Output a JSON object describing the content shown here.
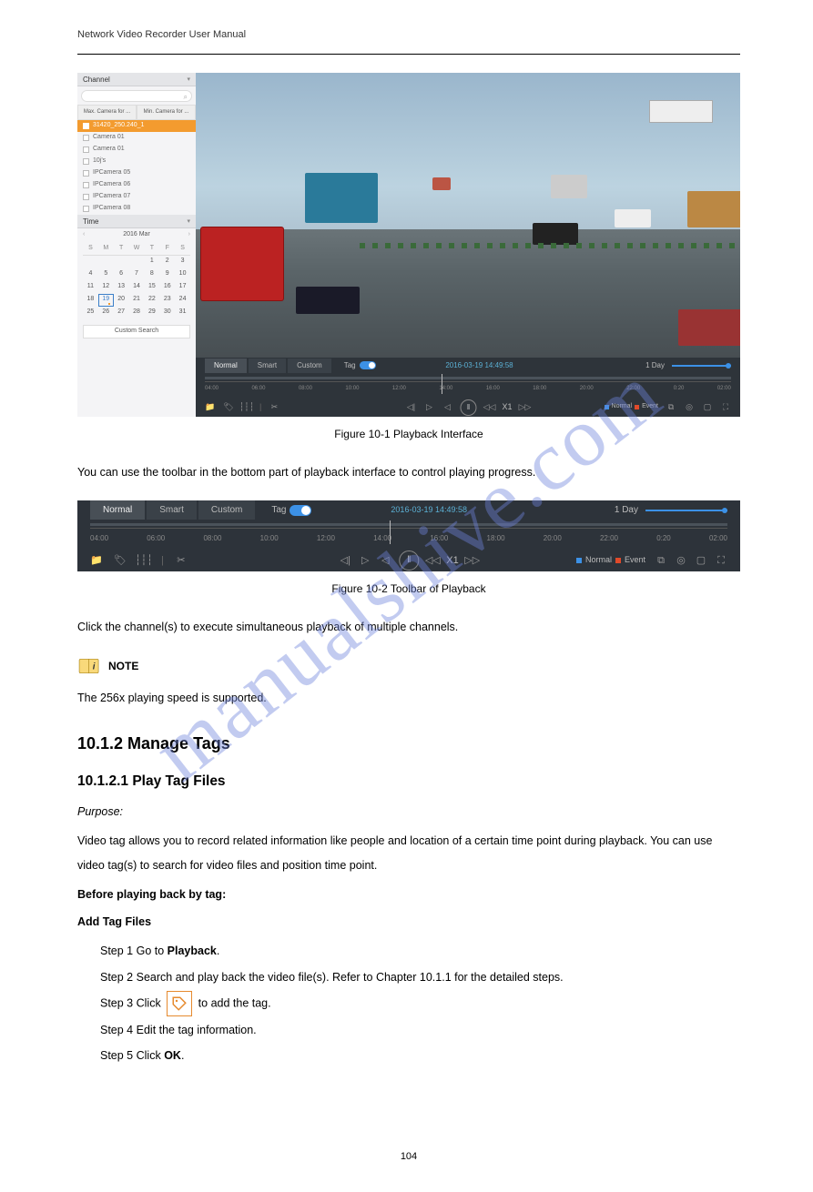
{
  "header": "Network Video Recorder User Manual",
  "watermark": "manualshive.com",
  "footer_page": "104",
  "fig1": {
    "channel_label": "Channel",
    "tab1": "Max. Camera for ...",
    "tab2": "Min. Camera for ...",
    "cams": [
      "31420_250.240_1",
      "Camera 01",
      "Camera 01",
      "10j's",
      "IPCamera 05",
      "IPCamera 06",
      "IPCamera 07",
      "IPCamera 08"
    ],
    "time_label": "Time",
    "cal_month": "2016 Mar",
    "dow": [
      "S",
      "M",
      "T",
      "W",
      "T",
      "F",
      "S"
    ],
    "today": "19",
    "custom_search": "Custom Search",
    "type_normal": "Normal",
    "type_smart": "Smart",
    "type_custom": "Custom",
    "tag": "Tag",
    "timestamp": "2016-03-19 14:49:58",
    "one_day": "1 Day",
    "speed": "X1",
    "leg_normal": "Normal",
    "leg_event": "Event",
    "tl_times": [
      "04:00",
      "06:00",
      "08:00",
      "10:00",
      "12:00",
      "14:00",
      "16:00",
      "18:00",
      "20:00",
      "22:00",
      "0:20",
      "02:00"
    ]
  },
  "fig1_caption": "Figure 10-1 Playback Interface",
  "fig2_caption": "Figure 10-2 Toolbar of Playback",
  "body": {
    "line_toolbar": "You can use the toolbar in the bottom part of playback interface to control playing progress.",
    "line_manage": "Click the channel(s) to execute simultaneous playback of multiple channels.",
    "note_label": "NOTE",
    "note_l1": "The 256x playing speed is supported.",
    "h1": "10.1.2 Manage Tags",
    "h2": "10.1.2.1 Play Tag Files",
    "purpose_label": "Purpose:",
    "purpose": "Video tag allows you to record related information like people and location of a certain time point during playback. You can use video tag(s) to search for video files and position time point.",
    "before_h": "Before playing back by tag:",
    "add_h": "Add Tag Files",
    "step1_lead": "Step 1 ",
    "step1": "Go to Playback.",
    "step2_lead": "Step 2 ",
    "step2": "Search and play back the video file(s). Refer to Chapter 10.1.1 for the detailed steps.",
    "step3_lead": "Step 3 ",
    "step3a": "Click ",
    "step3b": " to add the tag.",
    "step4_lead": "Step 4 ",
    "step4": "Edit the tag information.",
    "step5_lead": "Step 5 ",
    "step5": "Click OK."
  }
}
